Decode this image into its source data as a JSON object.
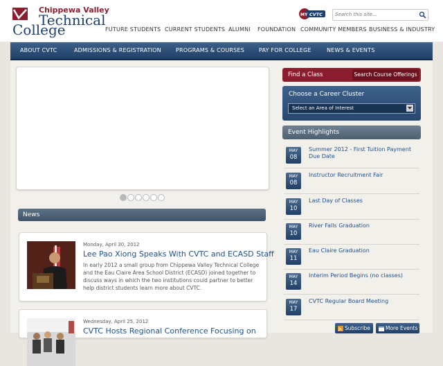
{
  "brand": {
    "line1": "Chippewa Valley",
    "line2": "Technical",
    "line3": "College",
    "accent": "#8c1d2e",
    "primary": "#1d3e70"
  },
  "mycvtc": {
    "my": "MY",
    "cvtc": "CVTC"
  },
  "search": {
    "placeholder": "Search this site...",
    "icon": "search-icon"
  },
  "topnav": [
    "FUTURE STUDENTS",
    "CURRENT STUDENTS",
    "ALUMNI",
    "FOUNDATION",
    "COMMUNITY MEMBERS",
    "BUSINESS & INDUSTRY"
  ],
  "mainnav": [
    "ABOUT CVTC",
    "ADMISSIONS & REGISTRATION",
    "PROGRAMS & COURSES",
    "PAY FOR COLLEGE",
    "NEWS & EVENTS"
  ],
  "slider": {
    "dot_count": 6,
    "active_index": 0
  },
  "news": {
    "heading": "News",
    "items": [
      {
        "date": "Monday, April 30, 2012",
        "title": "Lee Pao Xiong Speaks With CVTC and ECASD Staff",
        "body": "In early 2012 a small group from Chippewa Valley Technical College and the Eau Claire Area School District (ECASD) joined together to discuss ways in which the two institutions could partner to better help district students learn more about CVTC."
      },
      {
        "date": "Wednesday, April 25, 2012",
        "title": "CVTC Hosts Regional Conference Focusing on"
      }
    ]
  },
  "find": {
    "label": "Find a Class",
    "button": "Search Course Offerings"
  },
  "career": {
    "label": "Choose a Career Cluster",
    "select": "Select an Area of Interest"
  },
  "events": {
    "heading": "Event Highlights",
    "items": [
      {
        "month": "MAY",
        "day": "08",
        "title": "Summer 2012 - First Tuition Payment Due Date"
      },
      {
        "month": "MAY",
        "day": "08",
        "title": "Instructor Recruitment Fair"
      },
      {
        "month": "MAY",
        "day": "10",
        "title": "Last Day of Classes"
      },
      {
        "month": "MAY",
        "day": "10",
        "title": "River Falls Graduation"
      },
      {
        "month": "MAY",
        "day": "11",
        "title": "Eau Claire Graduation"
      },
      {
        "month": "MAY",
        "day": "14",
        "title": "Interim Period Begins (no classes)"
      },
      {
        "month": "MAY",
        "day": "17",
        "title": "CVTC Regular Board Meeting"
      }
    ]
  },
  "buttons": {
    "subscribe": "Subscribe",
    "more_events": "More Events"
  }
}
